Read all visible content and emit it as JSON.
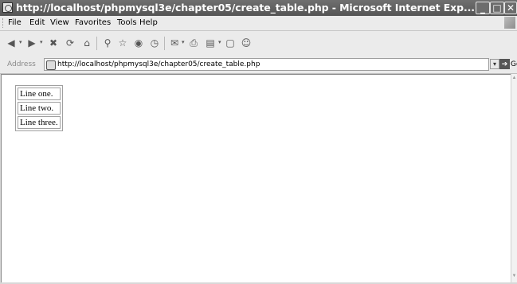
{
  "window": {
    "title": "http://localhost/phpmysql3e/chapter05/create_table.php - Microsoft Internet Exp...",
    "buttons": {
      "minimize": "_",
      "maximize": "□",
      "close": "✕"
    }
  },
  "menu": [
    "File",
    "Edit",
    "View",
    "Favorites",
    "Tools",
    "Help"
  ],
  "toolbar": {
    "icons": [
      "back-icon",
      "forward-icon",
      "stop-icon",
      "refresh-icon",
      "home-icon",
      "search-icon",
      "favorites-icon",
      "media-icon",
      "history-icon",
      "mail-icon",
      "print-icon",
      "edit-icon",
      "discuss-icon",
      "messenger-icon"
    ]
  },
  "address": {
    "label": "Address",
    "url": "http://localhost/phpmysql3e/chapter05/create_table.php",
    "go_label": "Go"
  },
  "table": {
    "rows": [
      "Line one.",
      "Line two.",
      "Line three."
    ]
  }
}
